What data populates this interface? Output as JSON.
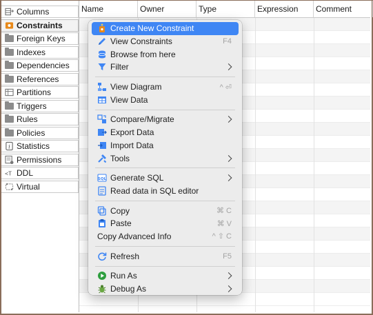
{
  "tabs": [
    {
      "label": "Columns",
      "icon": "columns-icon"
    },
    {
      "label": "Constraints",
      "icon": "constraint-icon",
      "active": true
    },
    {
      "label": "Foreign Keys",
      "icon": "folder-icon"
    },
    {
      "label": "Indexes",
      "icon": "folder-icon"
    },
    {
      "label": "Dependencies",
      "icon": "folder-icon"
    },
    {
      "label": "References",
      "icon": "folder-icon"
    },
    {
      "label": "Partitions",
      "icon": "partitions-icon"
    },
    {
      "label": "Triggers",
      "icon": "folder-icon"
    },
    {
      "label": "Rules",
      "icon": "folder-icon"
    },
    {
      "label": "Policies",
      "icon": "folder-icon"
    },
    {
      "label": "Statistics",
      "icon": "info-icon"
    },
    {
      "label": "Permissions",
      "icon": "permissions-icon"
    },
    {
      "label": "DDL",
      "icon": "ddl-icon"
    },
    {
      "label": "Virtual",
      "icon": "virtual-icon"
    }
  ],
  "table": {
    "columns": [
      "Name",
      "Owner",
      "Type",
      "Expression",
      "Comment"
    ]
  },
  "menu": {
    "items": [
      {
        "label": "Create New Constraint",
        "icon": "constraint-add-icon",
        "highlighted": true
      },
      {
        "label": "View Constraints",
        "icon": "pencil-icon",
        "shortcut": "F4"
      },
      {
        "label": "Browse from here",
        "icon": "database-icon"
      },
      {
        "label": "Filter",
        "icon": "filter-icon",
        "submenu": true
      },
      {
        "separator": true
      },
      {
        "label": "View Diagram",
        "icon": "diagram-icon",
        "shortcut": "^ ⏎"
      },
      {
        "label": "View Data",
        "icon": "table-icon"
      },
      {
        "separator": true
      },
      {
        "label": "Compare/Migrate",
        "icon": "compare-icon",
        "submenu": true
      },
      {
        "label": "Export Data",
        "icon": "export-icon"
      },
      {
        "label": "Import Data",
        "icon": "import-icon"
      },
      {
        "label": "Tools",
        "icon": "tools-icon",
        "submenu": true
      },
      {
        "separator": true
      },
      {
        "label": "Generate SQL",
        "icon": "sql-icon",
        "submenu": true
      },
      {
        "label": "Read data in SQL editor",
        "icon": "sql-editor-icon"
      },
      {
        "separator": true
      },
      {
        "label": "Copy",
        "icon": "copy-icon",
        "shortcut": "⌘ C"
      },
      {
        "label": "Paste",
        "icon": "paste-icon",
        "shortcut": "⌘ V"
      },
      {
        "label": "Copy Advanced Info",
        "shortcut": "^ ⇧ C"
      },
      {
        "separator": true
      },
      {
        "label": "Refresh",
        "icon": "refresh-icon",
        "shortcut": "F5"
      },
      {
        "separator": true
      },
      {
        "label": "Run As",
        "icon": "run-icon",
        "submenu": true
      },
      {
        "label": "Debug As",
        "icon": "debug-icon",
        "submenu": true
      }
    ]
  },
  "colors": {
    "highlight": "#3f86f4",
    "frame": "#8a6d5a",
    "constraint_icon": "#e8891a"
  }
}
